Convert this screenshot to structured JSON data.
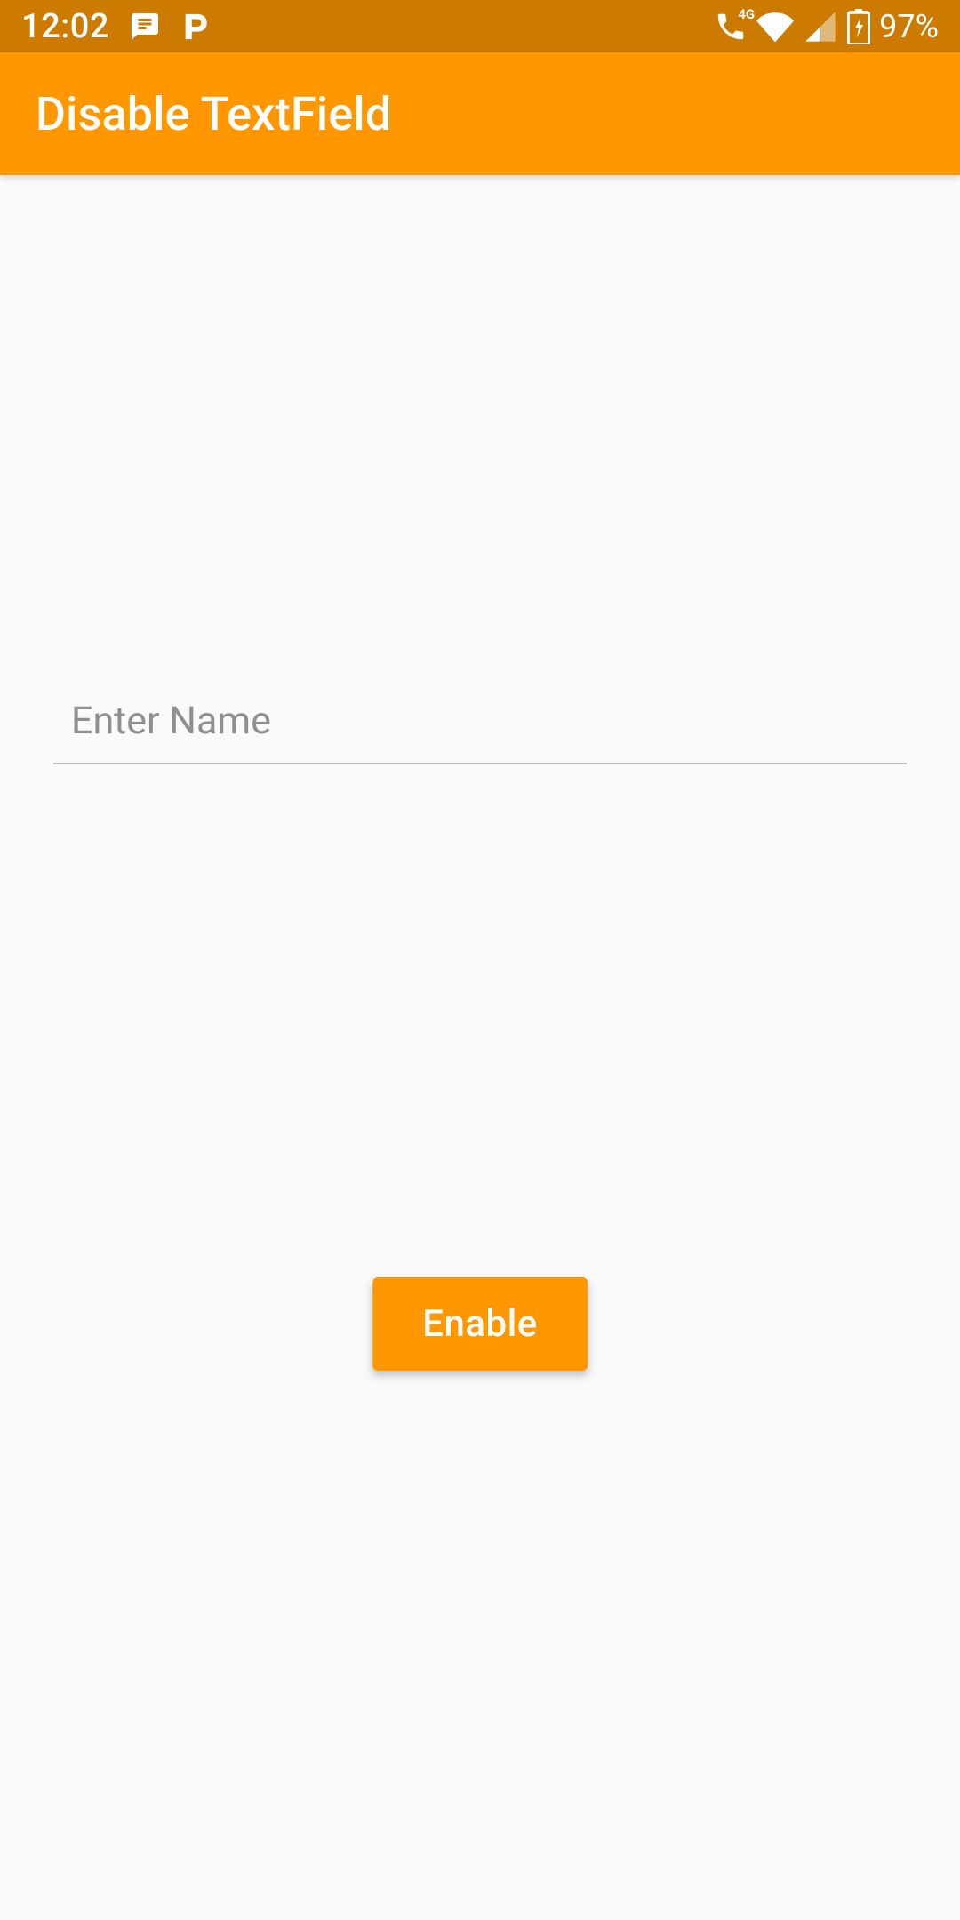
{
  "status": {
    "time": "12:02",
    "battery": "97%"
  },
  "appbar": {
    "title": "Disable TextField"
  },
  "form": {
    "name_placeholder": "Enter Name",
    "name_value": ""
  },
  "actions": {
    "toggle_label": "Enable"
  },
  "colors": {
    "status_bg": "#cc7a00",
    "appbar_bg": "#ff9800",
    "button_bg": "#ff9800"
  }
}
